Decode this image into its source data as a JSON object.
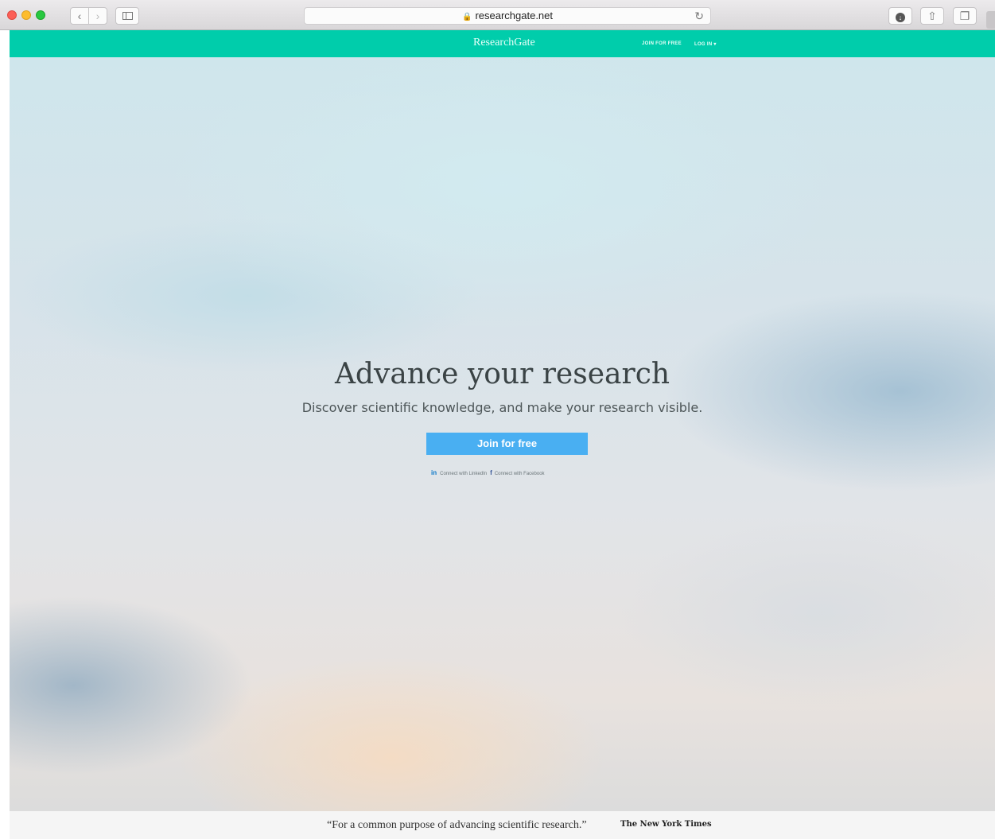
{
  "browser": {
    "url": "researchgate.net",
    "back_glyph": "‹",
    "forward_glyph": "›",
    "reload_glyph": "↻",
    "share_glyph": "⇧",
    "tabs_glyph": "❐"
  },
  "site": {
    "brand": "ResearchGate",
    "nav": {
      "join_label": "JOIN FOR FREE",
      "login_label": "LOG IN ▾"
    },
    "brand_color": "#00cdab"
  },
  "hero": {
    "headline": "Advance your research",
    "subheadline": "Discover scientific knowledge, and make your research visible.",
    "cta_label": "Join for free",
    "cta_color": "#49aff2",
    "social": {
      "linkedin_icon": "in",
      "linkedin_label": "Connect with LinkedIn",
      "facebook_icon": "f",
      "facebook_label": "Connect with Facebook"
    }
  },
  "footer": {
    "quote": "“For a common purpose of advancing scientific research.”",
    "source": "The New York Times"
  }
}
